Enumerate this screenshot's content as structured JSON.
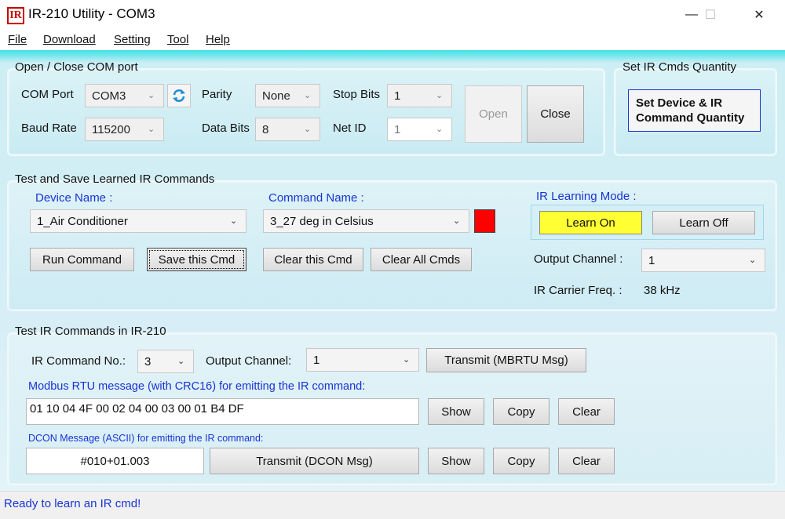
{
  "window": {
    "icon_text": "IR",
    "title": "IR-210 Utility - COM3",
    "controls": {
      "minimize": "—",
      "maximize": "☐",
      "close": "✕"
    }
  },
  "menu": [
    {
      "label": "File"
    },
    {
      "label": "Download"
    },
    {
      "label": "Setting"
    },
    {
      "label": "Tool"
    },
    {
      "label": "Help"
    }
  ],
  "com_group": {
    "title": "Open / Close COM port",
    "com_port_label": "COM Port",
    "com_port_value": "COM3",
    "baud_label": "Baud Rate",
    "baud_value": "115200",
    "parity_label": "Parity",
    "parity_value": "None",
    "data_bits_label": "Data Bits",
    "data_bits_value": "8",
    "stop_bits_label": "Stop Bits",
    "stop_bits_value": "1",
    "net_id_label": "Net ID",
    "net_id_value": "1",
    "open_label": "Open",
    "close_label": "Close",
    "refresh_icon": "refresh-icon"
  },
  "qty_group": {
    "title": "Set IR Cmds Quantity",
    "button_line1": "Set Device & IR",
    "button_line2": "Command Quantity"
  },
  "learn_group": {
    "title": "Test and Save Learned IR Commands",
    "device_name_label": "Device Name :",
    "device_name_value": "1_Air Conditioner",
    "command_name_label": "Command Name :",
    "command_name_value": "3_27 deg in Celsius",
    "indicator_color": "#ff0000",
    "run_command": "Run Command",
    "save_cmd": "Save this Cmd",
    "clear_cmd": "Clear this Cmd",
    "clear_all": "Clear All Cmds",
    "learning_mode_label": "IR Learning Mode :",
    "learn_on": "Learn On",
    "learn_off": "Learn Off",
    "output_channel_label": "Output Channel :",
    "output_channel_value": "1",
    "carrier_label": "IR Carrier Freq. :",
    "carrier_value": "38 kHz"
  },
  "test_group": {
    "title": "Test IR Commands in IR-210",
    "ir_cmd_no_label": "IR Command No.:",
    "ir_cmd_no_value": "3",
    "output_channel_label": "Output Channel:",
    "output_channel_value": "1",
    "transmit_mbrtu": "Transmit (MBRTU Msg)",
    "modbus_label": "Modbus RTU message (with CRC16) for emitting the IR command:",
    "modbus_value": "01 10 04 4F 00 02 04 00 03 00 01 B4 DF",
    "show": "Show",
    "copy": "Copy",
    "clear": "Clear",
    "dcon_label": "DCON Message (ASCII) for emitting the IR command:",
    "dcon_value": "#010+01.003",
    "transmit_dcon": "Transmit (DCON Msg)"
  },
  "status": {
    "text": "Ready to learn an IR cmd!"
  },
  "colors": {
    "accent_blue": "#1a33d6",
    "learn_on_bg": "#ffff33",
    "client_top": "#3ee0e6"
  }
}
